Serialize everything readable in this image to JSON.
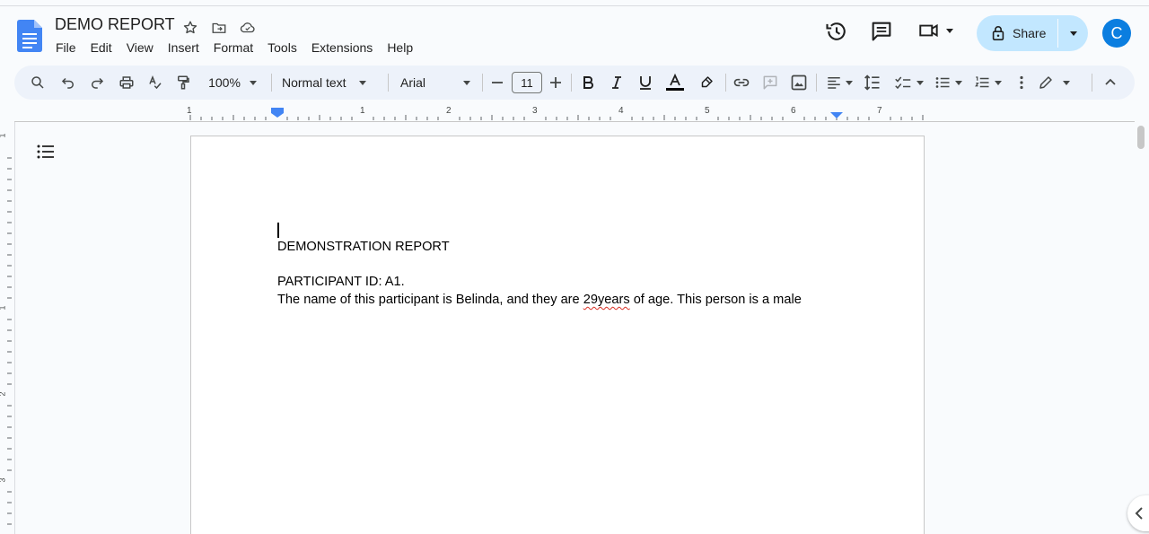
{
  "header": {
    "title": "DEMO REPORT",
    "menu": [
      "File",
      "Edit",
      "View",
      "Insert",
      "Format",
      "Tools",
      "Extensions",
      "Help"
    ],
    "share_label": "Share",
    "avatar_initial": "C"
  },
  "toolbar": {
    "zoom": "100%",
    "style": "Normal text",
    "font": "Arial",
    "font_size": "11"
  },
  "ruler": {
    "labels": [
      "1",
      "1",
      "2",
      "3",
      "4",
      "5",
      "6",
      "7"
    ],
    "v_labels": [
      "1",
      "1",
      "2",
      "3"
    ]
  },
  "document": {
    "line1": "DEMONSTRATION REPORT",
    "line2": "PARTICIPANT ID: A1.",
    "line3_before": "The name of this participant is Belinda, and they are ",
    "line3_misspelled": "29years",
    "line3_after": " of age. This person is a male"
  },
  "colors": {
    "accent": "#0b57d0",
    "share_bg": "#c2e7ff",
    "avatar_bg": "#0b7ee0",
    "toolbar_bg": "#edf2fa",
    "spellcheck": "#d93025"
  }
}
